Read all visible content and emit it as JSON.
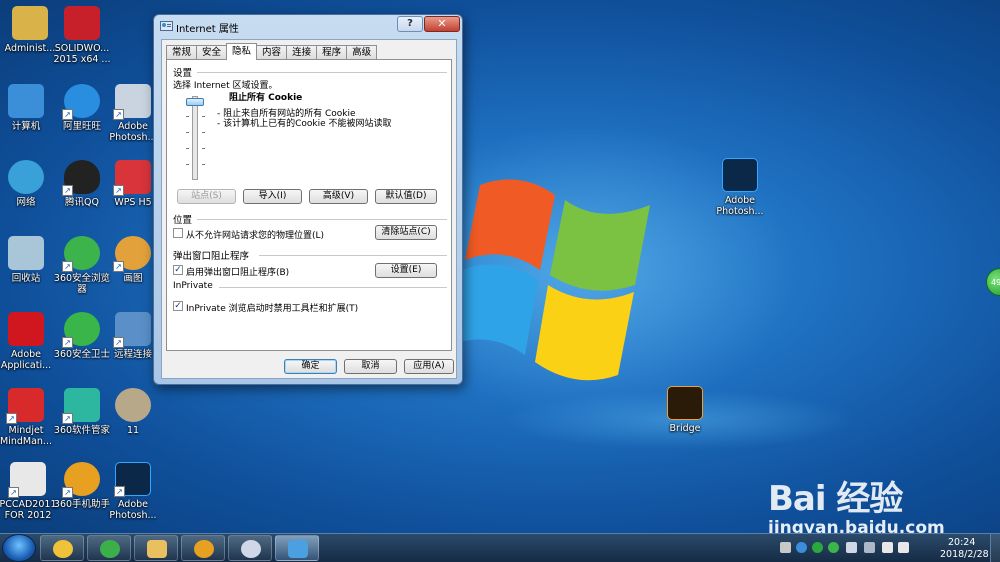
{
  "desktop": {
    "icons": [
      {
        "label": "Administ...",
        "icon": "user-folder-icon",
        "color": "#d9b24a"
      },
      {
        "label": "SOLIDWO... 2015 x64 ...",
        "icon": "solidworks-icon",
        "color": "#c8202a"
      },
      {
        "label": "计算机",
        "icon": "computer-icon",
        "color": "#3a8fd8"
      },
      {
        "label": "阿里旺旺",
        "icon": "aliwangwang-icon",
        "color": "#2a8ee0"
      },
      {
        "label": "Adobe Photosh...",
        "icon": "photoshop-icon",
        "color": "#c9d4e0"
      },
      {
        "label": "网络",
        "icon": "network-icon",
        "color": "#3aa0d8"
      },
      {
        "label": "腾讯QQ",
        "icon": "qq-icon",
        "color": "#222222"
      },
      {
        "label": "WPS H5",
        "icon": "wps-icon",
        "color": "#d8343a"
      },
      {
        "label": "回收站",
        "icon": "recycle-bin-icon",
        "color": "#a9c6d8"
      },
      {
        "label": "360安全浏览器",
        "icon": "360-browser-icon",
        "color": "#3cb44b"
      },
      {
        "label": "画图",
        "icon": "paint-icon",
        "color": "#e2a13a"
      },
      {
        "label": "Adobe Applicati...",
        "icon": "adobe-app-icon",
        "color": "#d0161f"
      },
      {
        "label": "360安全卫士",
        "icon": "360-safe-icon",
        "color": "#39b54a"
      },
      {
        "label": "远程连接",
        "icon": "remote-desktop-icon",
        "color": "#5a8fc8"
      },
      {
        "label": "Mindjet MindMan...",
        "icon": "mindjet-icon",
        "color": "#d82a2a"
      },
      {
        "label": "360软件管家",
        "icon": "360-software-icon",
        "color": "#2eb7a0"
      },
      {
        "label": "11",
        "icon": "image-file-icon",
        "color": "#b8a88a"
      },
      {
        "label": "PCCAD2011 FOR 2012",
        "icon": "pccad-icon",
        "color": "#e8e8e8"
      },
      {
        "label": "360手机助手",
        "icon": "360-phone-icon",
        "color": "#e8a020"
      },
      {
        "label": "Adobe Photosh...",
        "icon": "photoshop-icon",
        "color": "#0b2848"
      },
      {
        "label": "Adobe Photosh...",
        "icon": "photoshop-icon",
        "color": "#0b2848"
      },
      {
        "label": "Bridge",
        "icon": "bridge-icon",
        "color": "#2a1a08"
      }
    ],
    "side_badge": "49"
  },
  "dialog": {
    "title": "Internet 属性",
    "help": "?",
    "close": "✕",
    "tabs": [
      "常规",
      "安全",
      "隐私",
      "内容",
      "连接",
      "程序",
      "高级"
    ],
    "active_tab": "隐私",
    "settings": {
      "heading": "设置",
      "zone_text": "选择 Internet 区域设置。",
      "level_title": "阻止所有 Cookie",
      "level_desc_1": "- 阻止来自所有网站的所有 Cookie",
      "level_desc_2": "- 该计算机上已有的Cookie 不能被网站读取",
      "sites_btn": "站点(S)",
      "import_btn": "导入(I)",
      "advanced_btn": "高级(V)",
      "default_btn": "默认值(D)"
    },
    "location": {
      "heading": "位置",
      "checkbox_label": "从不允许网站请求您的物理位置(L)",
      "checked": false,
      "clear_btn": "清除站点(C)"
    },
    "popup": {
      "heading": "弹出窗口阻止程序",
      "checkbox_label": "启用弹出窗口阻止程序(B)",
      "checked": true,
      "settings_btn": "设置(E)"
    },
    "inprivate": {
      "heading": "InPrivate",
      "checkbox_label": "InPrivate 浏览启动时禁用工具栏和扩展(T)",
      "checked": true
    },
    "footer": {
      "ok": "确定",
      "cancel": "取消",
      "apply": "应用(A)"
    }
  },
  "taskbar": {
    "items": [
      {
        "name": "360-safe-icon",
        "color": "#f0c23a"
      },
      {
        "name": "ie-icon",
        "color": "#3bb04a"
      },
      {
        "name": "folder-icon",
        "color": "#e8c060"
      },
      {
        "name": "360-phone-icon",
        "color": "#e8a020"
      },
      {
        "name": "paint-icon",
        "color": "#d0d8e8"
      },
      {
        "name": "control-panel-icon",
        "color": "#4aa0e0"
      }
    ],
    "clock_time": "20:24",
    "clock_date": "2018/2/28"
  },
  "watermark": {
    "brand": "Bai 经验",
    "url": "jingyan.baidu.com"
  }
}
